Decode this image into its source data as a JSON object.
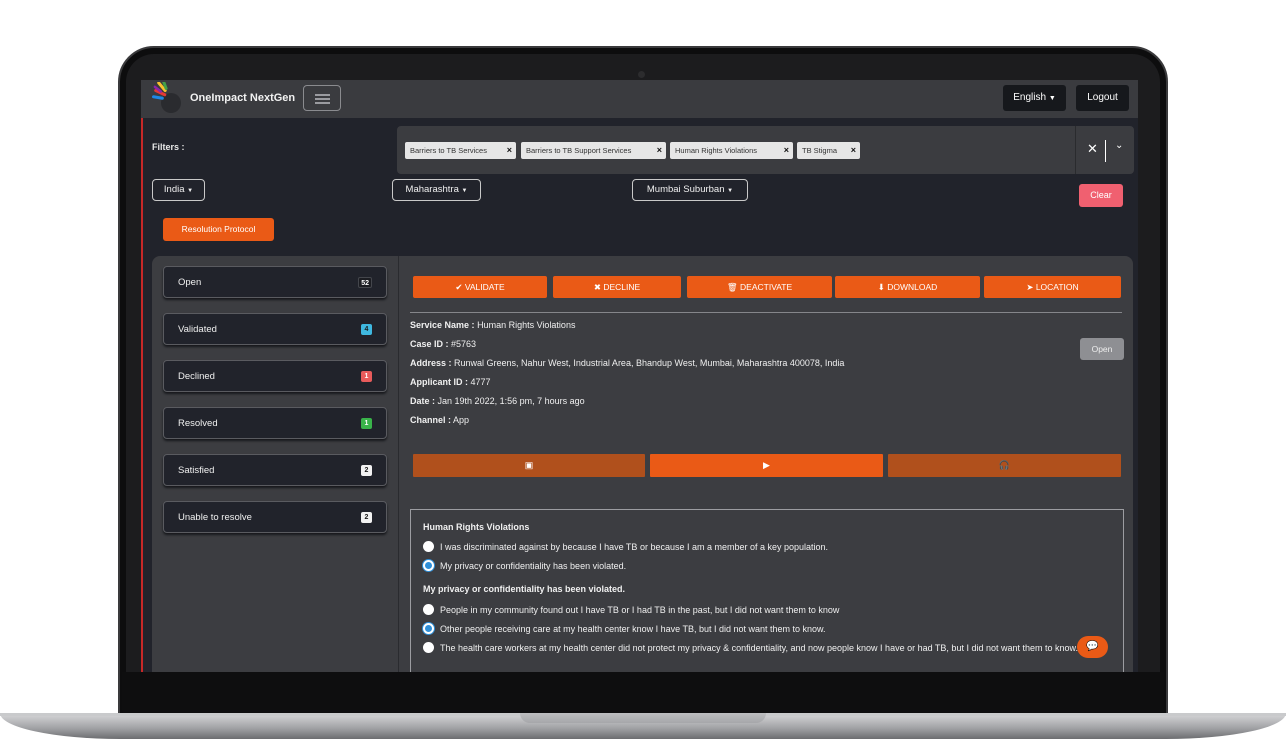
{
  "app": {
    "brand": "OneImpact NextGen",
    "language": "English",
    "logout": "Logout"
  },
  "filters": {
    "label": "Filters :",
    "chips": [
      "Barriers to TB Services",
      "Barriers to TB Support Services",
      "Human Rights Violations",
      "TB Stigma"
    ],
    "country": "India",
    "state": "Maharashtra",
    "district": "Mumbai Suburban",
    "clear": "Clear",
    "resolution_protocol": "Resolution Protocol"
  },
  "statuses": [
    {
      "label": "Open",
      "count": "52",
      "color": "#1c1d22",
      "text": "#ffffff"
    },
    {
      "label": "Validated",
      "count": "4",
      "color": "#3fb8e0",
      "text": "#1a1a1a"
    },
    {
      "label": "Declined",
      "count": "1",
      "color": "#e85b5b",
      "text": "#ffffff"
    },
    {
      "label": "Resolved",
      "count": "1",
      "color": "#39b34a",
      "text": "#ffffff"
    },
    {
      "label": "Satisfied",
      "count": "2",
      "color": "#f2f2f2",
      "text": "#1a1a1a"
    },
    {
      "label": "Unable to resolve",
      "count": "2",
      "color": "#f2f2f2",
      "text": "#1a1a1a"
    }
  ],
  "actions": {
    "validate": "VALIDATE",
    "decline": "DECLINE",
    "deactivate": "DEACTIVATE",
    "download": "DOWNLOAD",
    "location": "LOCATION"
  },
  "case": {
    "service_label": "Service Name :",
    "service": "Human Rights Violations",
    "id_label": "Case ID :",
    "id": "#5763",
    "address_label": "Address :",
    "address": "Runwal Greens, Nahur West, Industrial Area, Bhandup West, Mumbai, Maharashtra 400078, India",
    "applicant_label": "Applicant ID :",
    "applicant": "4777",
    "date_label": "Date :",
    "date": "Jan 19th 2022, 1:56 pm, 7 hours ago",
    "channel_label": "Channel :",
    "channel": "App",
    "status": "Open"
  },
  "questions": {
    "q1_title": "Human Rights Violations",
    "q1_options": [
      "I was discriminated against by because I have TB or because I am a member of a key population.",
      "My privacy or confidentiality has been violated."
    ],
    "q2_title": "My privacy or confidentiality has been violated.",
    "q2_options": [
      "People in my community found out I have TB or I had TB in the past, but I did not want them to know",
      "Other people receiving care at my health center know I have TB, but I did not want them to know.",
      "The health care workers at my health center did not protect my privacy & confidentiality, and now people know I have or had TB, but I did not want them to know."
    ]
  },
  "colors": {
    "accent": "#ea5a16",
    "clear": "#f06070",
    "background": "#21232b",
    "panel": "#3c3d41"
  },
  "icons": [
    "menu-icon",
    "check-icon",
    "times-icon",
    "trash-icon",
    "download-icon",
    "location-arrow-icon",
    "image-icon",
    "play-icon",
    "headphones-icon",
    "chat-icon"
  ]
}
